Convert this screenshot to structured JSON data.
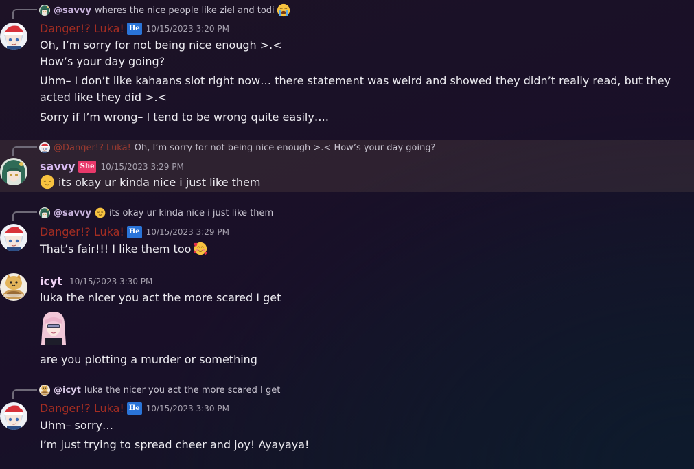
{
  "messages": {
    "m1": {
      "reply": {
        "user": "@savvy",
        "text": "wheres the nice people like ziel and todi",
        "emoji": "loudly-crying-emoji"
      },
      "author": "Danger!? Luka!",
      "pronoun_tag": "He",
      "timestamp": "10/15/2023 3:20 PM",
      "lines": [
        "Oh, I’m sorry for not being nice enough >.<",
        "How’s your day going?",
        "Uhm– I don’t like kahaans slot right now… there statement was weird and showed they didn’t really read, but they acted like they did >.<",
        "Sorry if I’m wrong– I tend to be wrong quite easily…."
      ]
    },
    "m2": {
      "reply": {
        "user": "@Danger!? Luka!",
        "text": "Oh, I’m sorry for not being nice enough >.< How’s your day going?"
      },
      "author": "savvy",
      "pronoun_tag": "She",
      "timestamp": "10/15/2023 3:29 PM",
      "emoji": "relieved-face-emoji",
      "text": "its okay ur kinda nice i just like them"
    },
    "m3": {
      "reply": {
        "user": "@savvy",
        "text": "its okay ur kinda nice i just like them",
        "emoji": "relieved-face-emoji"
      },
      "author": "Danger!? Luka!",
      "pronoun_tag": "He",
      "timestamp": "10/15/2023 3:29 PM",
      "text": "That’s fair!!! I like them too",
      "emoji": "smiling-face-with-hearts-emoji"
    },
    "m4": {
      "author": "icyt",
      "timestamp": "10/15/2023 3:30 PM",
      "line1": "luka the nicer you act the more scared I get",
      "sticker": "anime-girl-sticker",
      "line2": "are you plotting a murder or something"
    },
    "m5": {
      "reply": {
        "user": "@icyt",
        "text": "luka the nicer you act the more scared I get"
      },
      "author": "Danger!? Luka!",
      "pronoun_tag": "He",
      "timestamp": "10/15/2023 3:30 PM",
      "lines": [
        "Uhm– sorry…",
        "I’m just trying to spread cheer and joy! Ayayaya!"
      ]
    }
  },
  "colors": {
    "luka_name": "#a42d22",
    "savvy_name": "#d6b8ef",
    "icyt_name": "#efd2f5",
    "he_tag": "#2a74d8",
    "she_tag": "#e8386a"
  }
}
